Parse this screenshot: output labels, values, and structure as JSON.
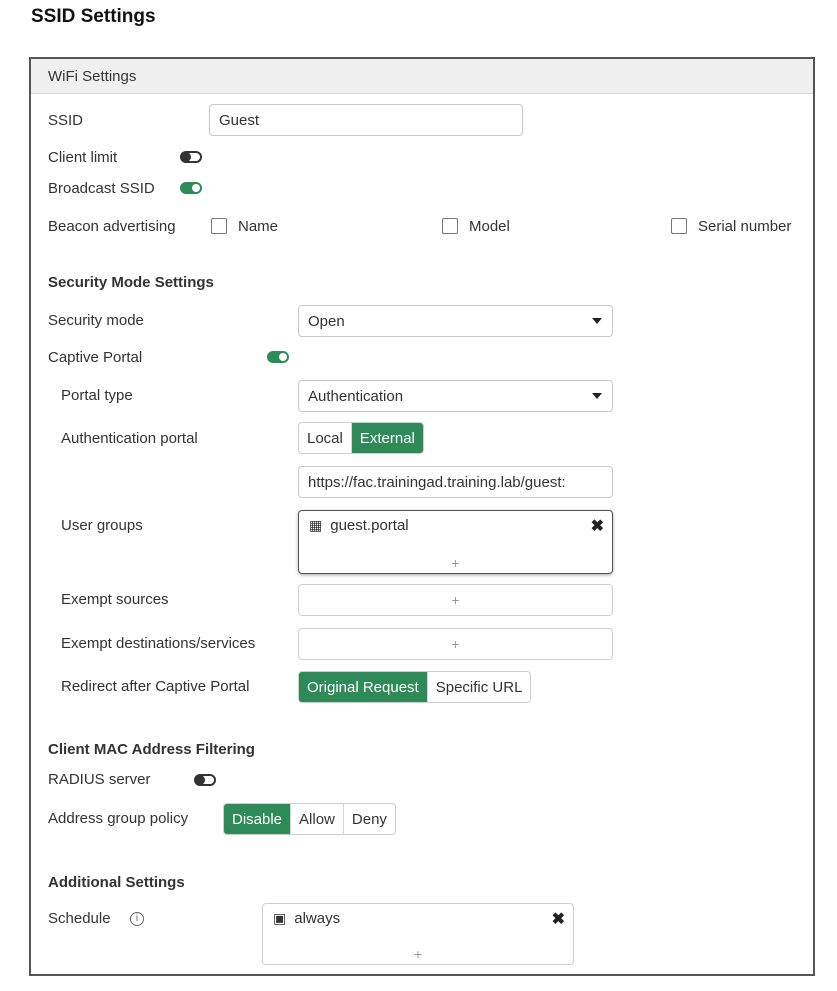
{
  "page_title": "SSID Settings",
  "wifi": {
    "header": "WiFi Settings",
    "ssid_label": "SSID",
    "ssid_value": "Guest",
    "client_limit_label": "Client limit",
    "broadcast_ssid_label": "Broadcast SSID",
    "beacon_label": "Beacon advertising",
    "beacon_options": [
      "Name",
      "Model",
      "Serial number"
    ]
  },
  "security": {
    "title": "Security Mode Settings",
    "mode_label": "Security mode",
    "mode_value": "Open",
    "captive_label": "Captive Portal",
    "portal_type_label": "Portal type",
    "portal_type_value": "Authentication",
    "auth_portal_label": "Authentication portal",
    "auth_portal_options": [
      "Local",
      "External"
    ],
    "auth_portal_selected": "External",
    "portal_url": "https://fac.trainingad.training.lab/guest:",
    "user_groups_label": "User groups",
    "user_groups": [
      "guest.portal"
    ],
    "add_symbol": "+",
    "exempt_sources_label": "Exempt sources",
    "exempt_dest_label": "Exempt destinations/services",
    "redirect_label": "Redirect after Captive Portal",
    "redirect_options": [
      "Original Request",
      "Specific URL"
    ],
    "redirect_selected": "Original Request"
  },
  "mac_filter": {
    "title": "Client MAC Address Filtering",
    "radius_label": "RADIUS server",
    "policy_label": "Address group policy",
    "policy_options": [
      "Disable",
      "Allow",
      "Deny"
    ],
    "policy_selected": "Disable"
  },
  "additional": {
    "title": "Additional Settings",
    "schedule_label": "Schedule",
    "schedule_value": "always"
  },
  "toggles": {
    "client_limit": false,
    "broadcast_ssid": true,
    "captive_portal": true,
    "radius_server": false
  },
  "colors": {
    "accent": "#2e8b57",
    "panel_border": "#555555",
    "header_bg": "#f0f0f0"
  },
  "icons": {
    "user_group": "group-icon",
    "schedule": "calendar-icon",
    "remove": "close-icon",
    "info": "info-icon",
    "dropdown": "caret-down-icon"
  }
}
